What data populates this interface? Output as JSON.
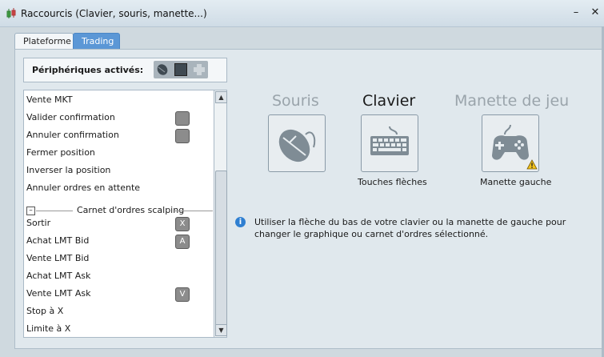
{
  "window": {
    "title": "Raccourcis (Clavier, souris, manette...)"
  },
  "tabs": [
    {
      "label": "Plateforme"
    },
    {
      "label": "Trading"
    }
  ],
  "devices_bar": {
    "label": "Périphériques activés:"
  },
  "shortcut_list": {
    "rows": [
      {
        "label": "Vente MKT",
        "key": ""
      },
      {
        "label": "Valider confirmation",
        "key": ""
      },
      {
        "label": "Annuler confirmation",
        "key": ""
      },
      {
        "label": "Fermer position",
        "key": ""
      },
      {
        "label": "Inverser la position",
        "key": ""
      },
      {
        "label": "Annuler ordres en attente",
        "key": ""
      }
    ],
    "section": {
      "label": "Carnet d'ordres scalping"
    },
    "section_rows": [
      {
        "label": "Sortir",
        "key": "X"
      },
      {
        "label": "Achat LMT Bid",
        "key": "A"
      },
      {
        "label": "Vente LMT Bid",
        "key": ""
      },
      {
        "label": "Achat LMT Ask",
        "key": ""
      },
      {
        "label": "Vente LMT Ask",
        "key": "V"
      },
      {
        "label": "Stop à X",
        "key": ""
      },
      {
        "label": "Limite à X",
        "key": ""
      }
    ]
  },
  "devices": {
    "mouse": {
      "title": "Souris",
      "caption": "",
      "color": "#9aa4ab"
    },
    "keyboard": {
      "title": "Clavier",
      "caption": "Touches flèches",
      "color": "#1a1a1a"
    },
    "gamepad": {
      "title": "Manette de jeu",
      "caption": "Manette gauche",
      "color": "#9aa4ab"
    }
  },
  "info": {
    "text": "Utiliser la flèche du bas de votre clavier ou la manette de gauche pour changer le graphique ou carnet d'ordres sélectionné."
  },
  "colors": {
    "accent": "#5b97d6",
    "warning": "#f2c21b"
  }
}
